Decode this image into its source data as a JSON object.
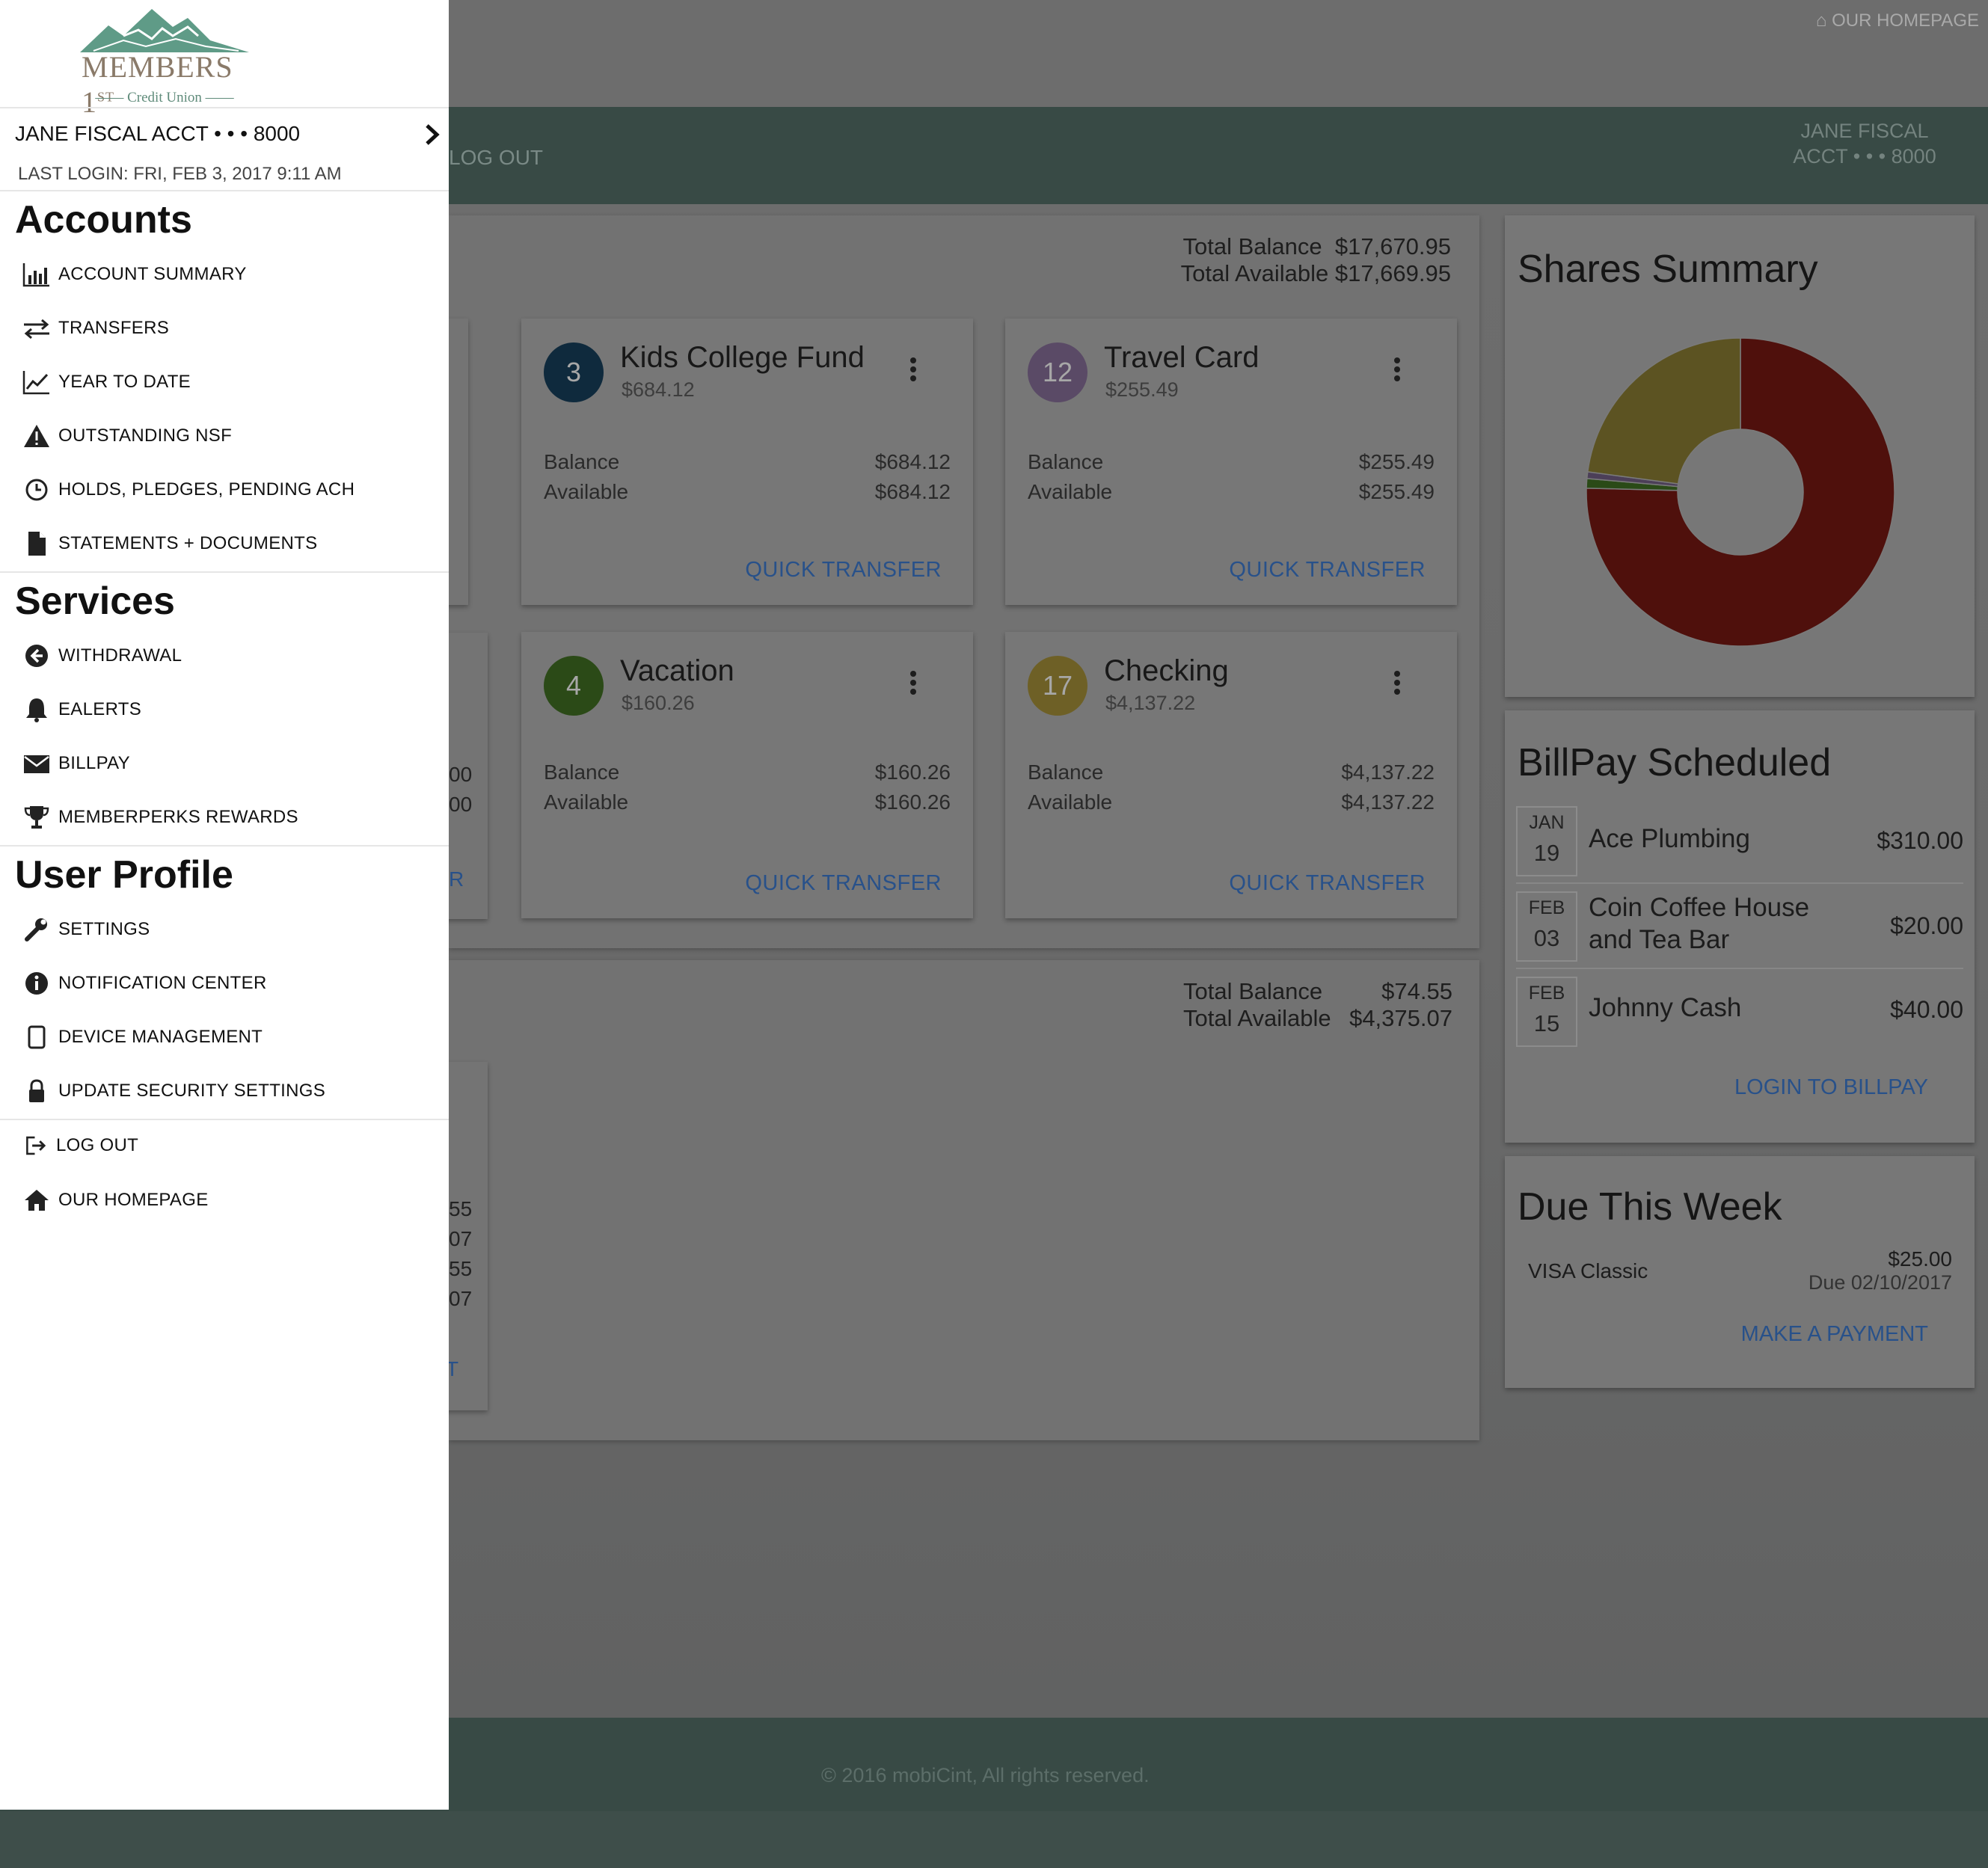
{
  "top": {
    "homepage": "OUR HOMEPAGE"
  },
  "header": {
    "logout": "LOG OUT",
    "acct_line1": "JANE FISCAL",
    "acct_line2": "ACCT • • • 8000"
  },
  "savings_panel": {
    "total_balance_label": "Total Balance",
    "total_balance": "$17,670.95",
    "total_available_label": "Total Available",
    "total_available": "$17,669.95"
  },
  "loans_panel": {
    "total_balance_label": "Total Balance",
    "total_balance": "$74.55",
    "total_available_label": "Total Available",
    "total_available": "$4,375.07"
  },
  "accounts": [
    {
      "badge": "3",
      "badge_color": "#0f2a3d",
      "name": "Kids College Fund",
      "amount": "$684.12",
      "balance_label": "Balance",
      "balance": "$684.12",
      "available_label": "Available",
      "available": "$684.12",
      "action": "QUICK TRANSFER"
    },
    {
      "badge": "12",
      "badge_color": "#5a4a66",
      "name": "Travel Card",
      "amount": "$255.49",
      "balance_label": "Balance",
      "balance": "$255.49",
      "available_label": "Available",
      "available": "$255.49",
      "action": "QUICK TRANSFER"
    },
    {
      "badge": "4",
      "badge_color": "#2b4a17",
      "name": "Vacation",
      "amount": "$160.26",
      "balance_label": "Balance",
      "balance": "$160.26",
      "available_label": "Available",
      "available": "$160.26",
      "action": "QUICK TRANSFER"
    },
    {
      "badge": "17",
      "badge_color": "#6e6026",
      "name": "Checking",
      "amount": "$4,137.22",
      "balance_label": "Balance",
      "balance": "$4,137.22",
      "available_label": "Available",
      "available": "$4,137.22",
      "action": "QUICK TRANSFER"
    }
  ],
  "hidden_edge_text": [
    "00",
    "00",
    "R",
    "55",
    "07",
    "55",
    "07",
    "T"
  ],
  "shares_summary": {
    "title": "Shares Summary",
    "chart_data": {
      "type": "pie",
      "values": [
        75.4,
        1.0,
        0.7,
        22.9
      ],
      "colors": [
        "#4f100c",
        "#2a4a17",
        "#4c3f58",
        "#5c5322"
      ]
    }
  },
  "billpay": {
    "title": "BillPay Scheduled",
    "items": [
      {
        "month": "JAN",
        "day": "19",
        "payee_line1": "Ace Plumbing",
        "payee_line2": "",
        "amount": "$310.00"
      },
      {
        "month": "FEB",
        "day": "03",
        "payee_line1": "Coin Coffee House",
        "payee_line2": "and Tea Bar",
        "amount": "$20.00"
      },
      {
        "month": "FEB",
        "day": "15",
        "payee_line1": "Johnny Cash",
        "payee_line2": "",
        "amount": "$40.00"
      }
    ],
    "link": "LOGIN TO BILLPAY"
  },
  "due": {
    "title": "Due This Week",
    "name": "VISA Classic",
    "amount": "$25.00",
    "due_date": "Due 02/10/2017",
    "link": "MAKE A PAYMENT"
  },
  "footer": {
    "copyright": "© 2016 mobiCint, All rights reserved."
  },
  "drawer": {
    "logo_text": "MEMBERS 1",
    "logo_sup": "ST",
    "logo_sub": "Credit Union",
    "account": "JANE FISCAL ACCT • • • 8000",
    "last_login": "LAST LOGIN: FRI, FEB 3, 2017 9:11 AM",
    "sections": {
      "accounts": "Accounts",
      "services": "Services",
      "profile": "User Profile"
    },
    "accounts_items": [
      "ACCOUNT SUMMARY",
      "TRANSFERS",
      "YEAR TO DATE",
      "OUTSTANDING NSF",
      "HOLDS, PLEDGES, PENDING ACH",
      "STATEMENTS + DOCUMENTS"
    ],
    "services_items": [
      "WITHDRAWAL",
      "EALERTS",
      "BILLPAY",
      "MEMBERPERKS REWARDS"
    ],
    "profile_items": [
      "SETTINGS",
      "NOTIFICATION CENTER",
      "DEVICE MANAGEMENT",
      "UPDATE SECURITY SETTINGS"
    ],
    "bottom_items": [
      "LOG OUT",
      "OUR HOMEPAGE"
    ]
  }
}
